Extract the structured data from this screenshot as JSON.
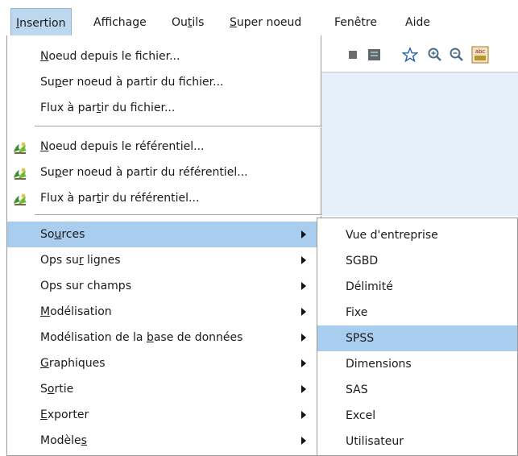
{
  "menubar": {
    "items": [
      {
        "pre": "",
        "ul": "I",
        "post": "nsertion"
      },
      {
        "pre": "Affichage",
        "ul": "",
        "post": ""
      },
      {
        "pre": "Ou",
        "ul": "t",
        "post": "ils"
      },
      {
        "pre": "",
        "ul": "S",
        "post": "uper noeud"
      },
      {
        "pre": "Fenêtre",
        "ul": "",
        "post": ""
      },
      {
        "pre": "Aide",
        "ul": "",
        "post": ""
      }
    ]
  },
  "toolbar": {
    "icons": [
      "stop-icon",
      "edit-icon",
      "star-icon",
      "zoom-in-icon",
      "zoom-out-icon",
      "spellcheck-icon"
    ],
    "spell_label": "abc"
  },
  "main_menu": {
    "items": [
      {
        "pre": "",
        "ul": "N",
        "post": "oeud depuis le fichier..."
      },
      {
        "pre": "Su",
        "ul": "p",
        "post": "er noeud à partir du fichier..."
      },
      {
        "pre": "Flux à par",
        "ul": "t",
        "post": "ir du fichier..."
      },
      {
        "pre": "",
        "ul": "N",
        "post": "oeud depuis le référentiel..."
      },
      {
        "pre": "Su",
        "ul": "p",
        "post": "er noeud à partir du référentiel..."
      },
      {
        "pre": "Flux à par",
        "ul": "t",
        "post": "ir du référentiel..."
      },
      {
        "pre": "So",
        "ul": "u",
        "post": "rces"
      },
      {
        "pre": "Ops su",
        "ul": "r",
        "post": " lignes"
      },
      {
        "pre": "Ops sur champs",
        "ul": "",
        "post": ""
      },
      {
        "pre": "",
        "ul": "M",
        "post": "odélisation"
      },
      {
        "pre": "Modélisation de la ",
        "ul": "b",
        "post": "ase de données"
      },
      {
        "pre": "",
        "ul": "G",
        "post": "raphiques"
      },
      {
        "pre": "S",
        "ul": "o",
        "post": "rtie"
      },
      {
        "pre": "",
        "ul": "E",
        "post": "xporter"
      },
      {
        "pre": "Modèle",
        "ul": "s",
        "post": ""
      }
    ]
  },
  "sub_menu": {
    "items": [
      "Vue d'entreprise",
      "SGBD",
      "Délimité",
      "Fixe",
      "SPSS",
      "Dimensions",
      "SAS",
      "Excel",
      "Utilisateur"
    ]
  },
  "colors": {
    "highlight": "#a8cdee",
    "canvas": "#e6f0fa"
  }
}
